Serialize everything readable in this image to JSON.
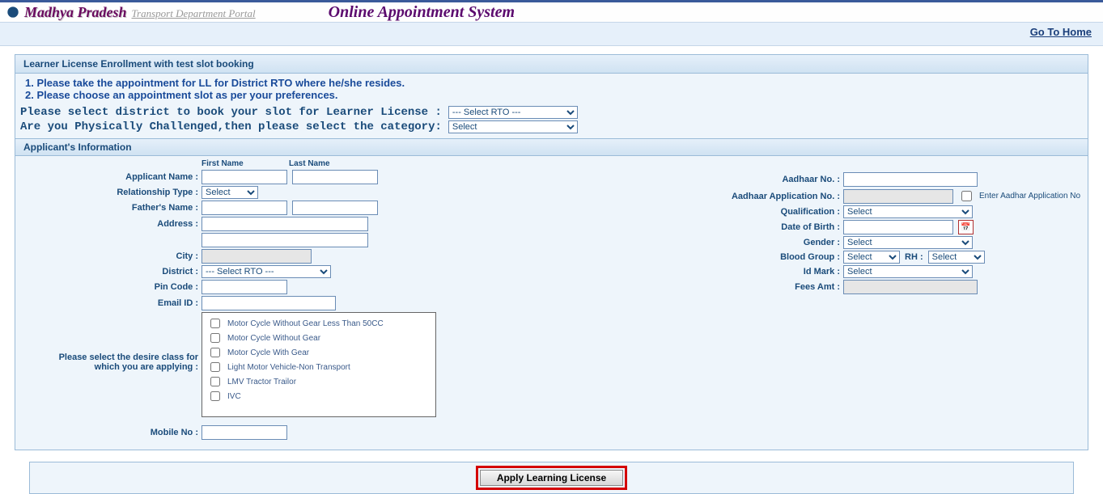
{
  "header": {
    "state": "Madhya Pradesh",
    "dept": "Transport Department Portal",
    "title": "Online Appointment System",
    "home_link": "Go To Home"
  },
  "panel_title": "Learner License Enrollment with test slot booking",
  "notices": [
    "1. Please take the appointment for LL for District RTO where he/she resides.",
    "2. Please choose an appointment slot as per your preferences."
  ],
  "rto_row": {
    "label": "Please select district to book your slot for Learner License :",
    "selected": "--- Select RTO ---"
  },
  "pc_row": {
    "label": "Are you Physically Challenged,then please select the category:",
    "selected": "Select"
  },
  "section_applicant": "Applicant's Information",
  "left": {
    "subhead_first": "First Name",
    "subhead_last": "Last Name",
    "applicant_name": "Applicant Name :",
    "relationship_type": "Relationship Type :",
    "relationship_selected": "Select",
    "father_name": "Father's Name :",
    "address": "Address :",
    "city": "City :",
    "district": "District :",
    "district_selected": "--- Select RTO ---",
    "pin": "Pin Code :",
    "email": "Email ID :",
    "cov_label1": "Please select the desire class for",
    "cov_label2": "which you are applying :",
    "mobile": "Mobile No :"
  },
  "right": {
    "aadhaar_no": "Aadhaar No. :",
    "aadhaar_app": "Aadhaar Application No. :",
    "aadhaar_check_label": "Enter Aadhar Application No",
    "qualification": "Qualification :",
    "qualification_selected": "Select",
    "dob": "Date of Birth :",
    "gender": "Gender :",
    "gender_selected": "Select",
    "blood": "Blood Group :",
    "blood_selected": "Select",
    "rh_label": "RH :",
    "rh_selected": "Select",
    "idmark": "Id Mark :",
    "idmark_selected": "Select",
    "fees": "Fees Amt :"
  },
  "cov_items": [
    "Motor Cycle Without Gear Less Than 50CC",
    "Motor Cycle Without Gear",
    "Motor Cycle With Gear",
    "Light Motor Vehicle-Non Transport",
    "LMV Tractor Trailor",
    "IVC"
  ],
  "apply_button": "Apply Learning License"
}
